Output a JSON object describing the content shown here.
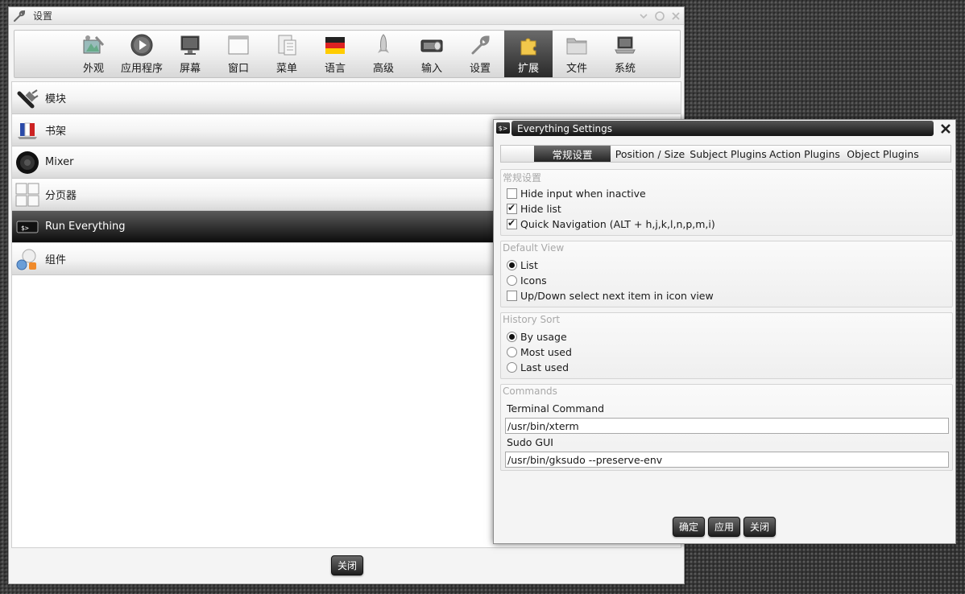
{
  "main_window": {
    "title": "设置",
    "title_icon": "wrench-icon",
    "toolbar": [
      {
        "label": "外观",
        "icon": "appearance-icon"
      },
      {
        "label": "应用程序",
        "icon": "play-icon"
      },
      {
        "label": "屏幕",
        "icon": "monitor-icon"
      },
      {
        "label": "窗口",
        "icon": "window-icon"
      },
      {
        "label": "菜单",
        "icon": "menu-icon"
      },
      {
        "label": "语言",
        "icon": "flag-icon"
      },
      {
        "label": "高级",
        "icon": "rocket-icon"
      },
      {
        "label": "输入",
        "icon": "keyboard-mouse-icon"
      },
      {
        "label": "设置",
        "icon": "wrench-icon"
      },
      {
        "label": "扩展",
        "icon": "puzzle-icon",
        "active": true
      },
      {
        "label": "文件",
        "icon": "folder-icon"
      },
      {
        "label": "系统",
        "icon": "laptop-icon"
      }
    ],
    "modules": [
      {
        "label": "模块",
        "icon": "plug-icon"
      },
      {
        "label": "书架",
        "icon": "shelf-icon"
      },
      {
        "label": "Mixer",
        "icon": "speaker-icon"
      },
      {
        "label": "分页器",
        "icon": "pager-icon"
      },
      {
        "label": "Run Everything",
        "icon": "terminal-icon",
        "selected": true
      },
      {
        "label": "组件",
        "icon": "gadgets-icon"
      }
    ],
    "close_label": "关闭"
  },
  "dialog": {
    "title": "Everything Settings",
    "tabs": [
      "常规设置",
      "Position / Size",
      "Subject Plugins",
      "Action Plugins",
      "Object Plugins"
    ],
    "general": {
      "title": "常规设置",
      "options": [
        {
          "label": "Hide input when inactive",
          "checked": false
        },
        {
          "label": "Hide list",
          "checked": true
        },
        {
          "label": "Quick Navigation (ALT + h,j,k,l,n,p,m,i)",
          "checked": true
        }
      ]
    },
    "default_view": {
      "title": "Default View",
      "radios": [
        {
          "label": "List",
          "selected": true
        },
        {
          "label": "Icons",
          "selected": false
        }
      ],
      "checkbox": {
        "label": "Up/Down select next item in icon view",
        "checked": false
      }
    },
    "history_sort": {
      "title": "History Sort",
      "radios": [
        {
          "label": "By usage",
          "selected": true
        },
        {
          "label": "Most used",
          "selected": false
        },
        {
          "label": "Last used",
          "selected": false
        }
      ]
    },
    "commands": {
      "title": "Commands",
      "terminal_label": "Terminal Command",
      "terminal_value": "/usr/bin/xterm",
      "sudo_label": "Sudo GUI",
      "sudo_value": "/usr/bin/gksudo --preserve-env"
    },
    "buttons": {
      "ok": "确定",
      "apply": "应用",
      "close": "关闭"
    }
  }
}
